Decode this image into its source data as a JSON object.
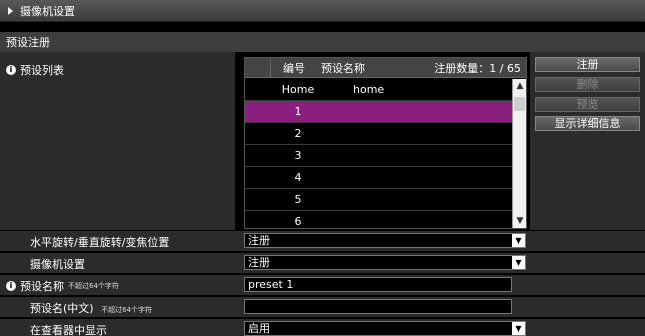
{
  "section": {
    "title": "摄像机设置"
  },
  "subsection": {
    "title": "预设注册"
  },
  "preset_list": {
    "label": "预设列表",
    "headers": {
      "number": "编号",
      "name": "预设名称",
      "count": "注册数量：1 / 65"
    },
    "rows": [
      {
        "number": "Home",
        "name": "home",
        "selected": false
      },
      {
        "number": "1",
        "name": "",
        "selected": true
      },
      {
        "number": "2",
        "name": "",
        "selected": false
      },
      {
        "number": "3",
        "name": "",
        "selected": false
      },
      {
        "number": "4",
        "name": "",
        "selected": false
      },
      {
        "number": "5",
        "name": "",
        "selected": false
      },
      {
        "number": "6",
        "name": "",
        "selected": false
      }
    ]
  },
  "buttons": {
    "register": "注册",
    "delete": "删除",
    "preview": "预览",
    "details": "显示详细信息"
  },
  "form": {
    "pan_tilt_zoom": {
      "label": "水平旋转/垂直旋转/变焦位置",
      "value": "注册"
    },
    "camera_settings": {
      "label": "摄像机设置",
      "value": "注册"
    },
    "preset_name": {
      "label": "预设名称",
      "note": "不超过64个字符",
      "value": "preset 1"
    },
    "preset_name_cn": {
      "label": "预设名(中文)",
      "note": "不超过64个字符",
      "value": ""
    },
    "show_in_viewer": {
      "label": "在查看器中显示",
      "value": "启用"
    }
  },
  "colors": {
    "selected_row": "#8a1f7f",
    "panel": "#2b2b2b"
  }
}
